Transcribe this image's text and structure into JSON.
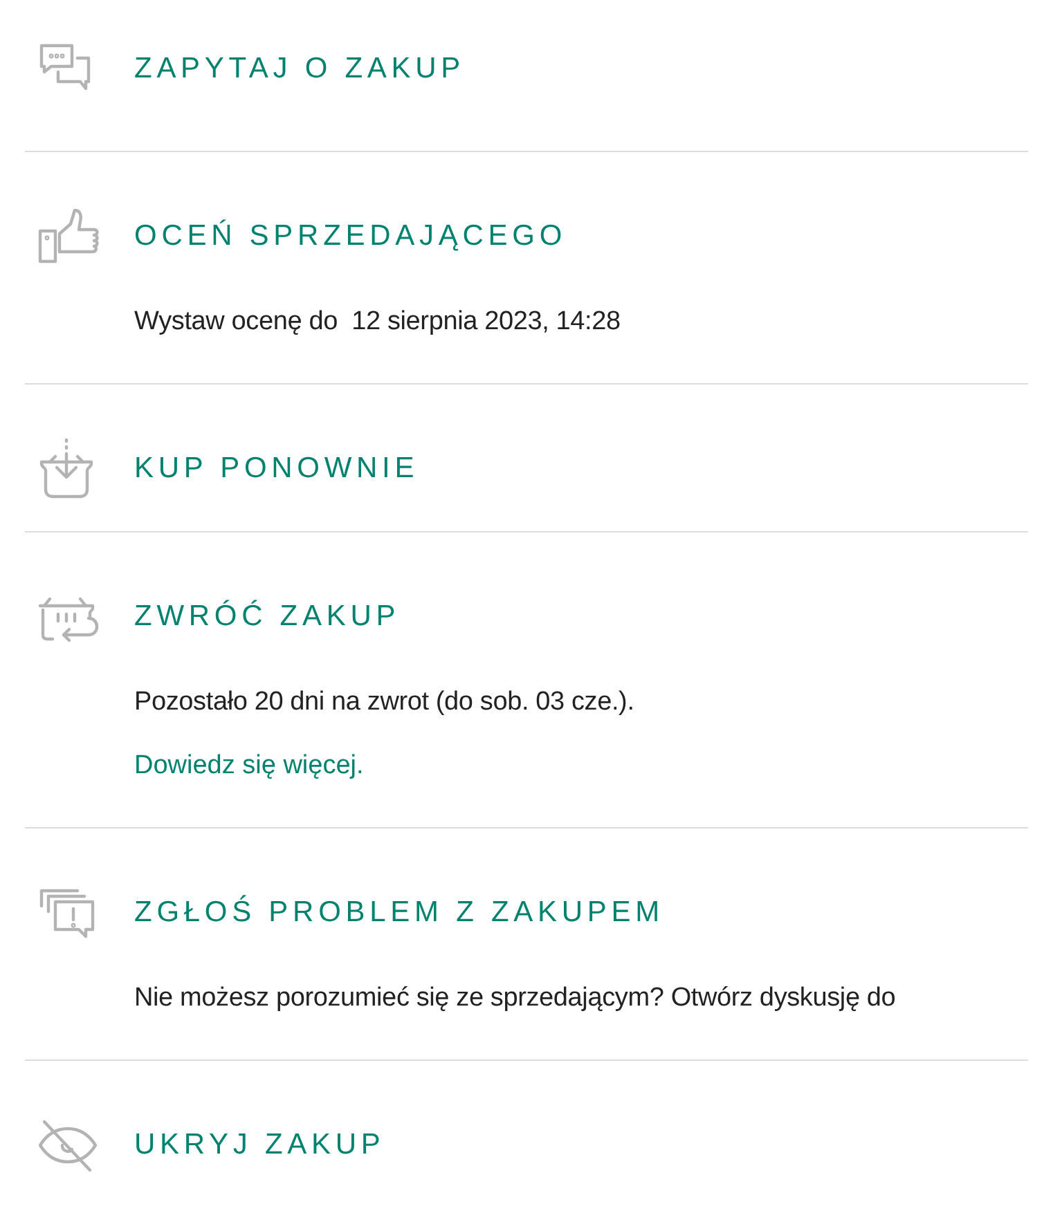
{
  "actions": [
    {
      "title": "ZAPYTAJ O ZAKUP"
    },
    {
      "title": "OCEŃ SPRZEDAJĄCEGO",
      "lines": [
        {
          "kind": "text",
          "text": "Wystaw ocenę do  12 sierpnia 2023, 14:28"
        }
      ]
    },
    {
      "title": "KUP PONOWNIE"
    },
    {
      "title": "ZWRÓĆ ZAKUP",
      "lines": [
        {
          "kind": "text",
          "text": "Pozostało 20 dni na zwrot (do sob. 03 cze.)."
        },
        {
          "kind": "link",
          "text": "Dowiedz się więcej."
        }
      ]
    },
    {
      "title": "ZGŁOŚ PROBLEM Z ZAKUPEM",
      "lines": [
        {
          "kind": "text",
          "text": "Nie możesz porozumieć się ze sprzedającym? Otwórz dyskusję do"
        }
      ]
    },
    {
      "title": "UKRYJ ZAKUP"
    }
  ]
}
